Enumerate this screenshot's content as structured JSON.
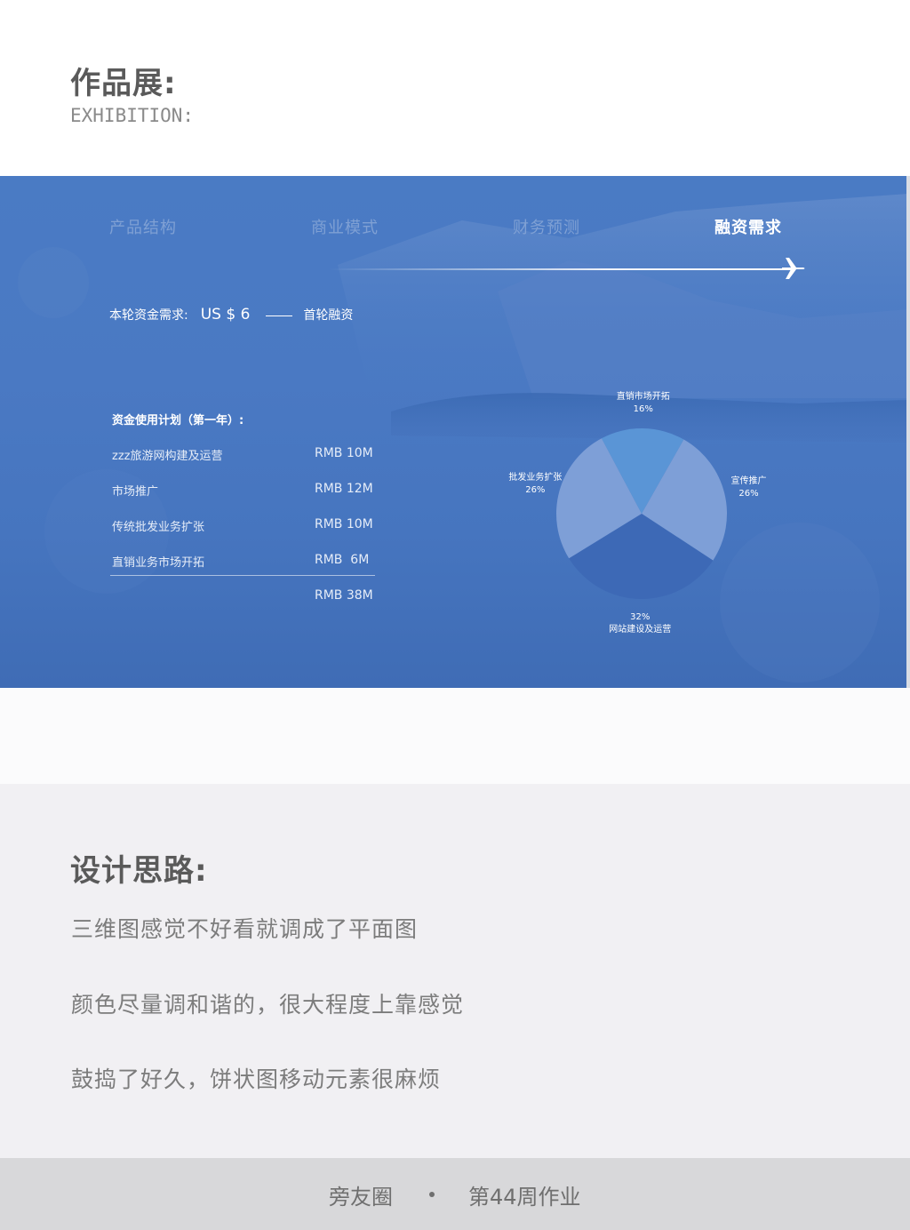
{
  "exhibition": {
    "title": "作品展:",
    "subtitle": "EXHIBITION:"
  },
  "slide": {
    "tabs": [
      {
        "label": "产品结构",
        "active": false
      },
      {
        "label": "商业模式",
        "active": false
      },
      {
        "label": "财务预测",
        "active": false
      },
      {
        "label": "融资需求",
        "active": true
      }
    ],
    "funding": {
      "label": "本轮资金需求:",
      "amount": "US $ 6",
      "round": "首轮融资"
    },
    "plan": {
      "title": "资金使用计划（第一年）:",
      "rows": [
        {
          "item": "zzz旅游网构建及运营",
          "value": "RMB 10M"
        },
        {
          "item": "市场推广",
          "value": "RMB 12M"
        },
        {
          "item": "传统批发业务扩张",
          "value": "RMB 10M"
        },
        {
          "item": "直销业务市场开拓",
          "value": "RMB  6M"
        }
      ],
      "total": "RMB 38M"
    },
    "chart_data": {
      "type": "pie",
      "title": "",
      "slices": [
        {
          "label": "直销市场开拓",
          "value": 16,
          "display": "16%",
          "color": "#5a95d6"
        },
        {
          "label": "宣传推广",
          "value": 26,
          "display": "26%",
          "color": "#7e9fd7"
        },
        {
          "label": "网站建设及运营",
          "value": 32,
          "display": "32%",
          "color": "#3d69b6"
        },
        {
          "label": "批发业务扩张",
          "value": 26,
          "display": "26%",
          "color": "#7e9fd7"
        }
      ]
    }
  },
  "design": {
    "title": "设计思路:",
    "lines": [
      "三维图感觉不好看就调成了平面图",
      "颜色尽量调和谐的，很大程度上靠感觉",
      "鼓捣了好久，饼状图移动元素很麻烦"
    ]
  },
  "footer": {
    "left": "旁友圈",
    "right": "第44周作业"
  },
  "colors": {
    "slide_bg": "#4a7bc4",
    "text_gray": "#7c7c7c",
    "footer_bg": "#d8d8da"
  }
}
